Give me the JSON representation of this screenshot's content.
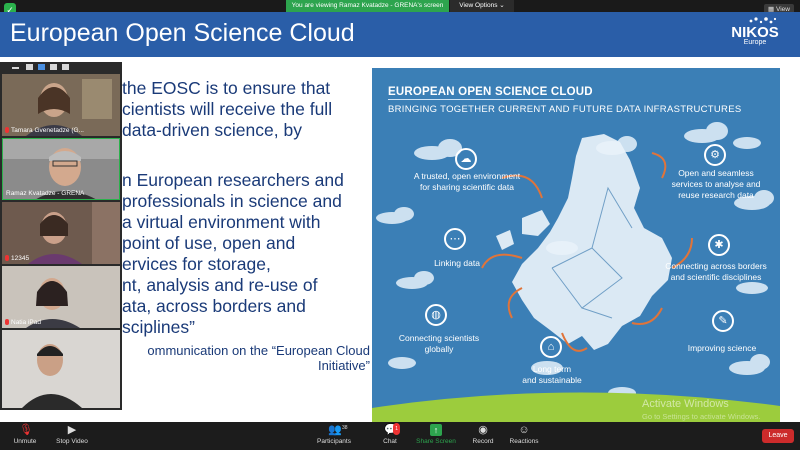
{
  "topbar": {
    "viewing_text": "You are viewing Ramaz Kvatadze - GRENA's screen",
    "view_options": "View Options ⌄",
    "view_label": "View"
  },
  "slide": {
    "title": "European Open Science Cloud",
    "logo": "NIKOS",
    "logo_sub": "Europe",
    "body": [
      "the EOSC is to ensure that",
      "cientists will receive the full",
      "data-driven science, by",
      "",
      "n European researchers and",
      "professionals in science and",
      "a virtual environment with",
      "point of use, open and",
      "ervices for storage,",
      "nt, analysis and re-use of",
      "ata, across borders and",
      "sciplines”"
    ],
    "quote_source_1": "ommunication on the “European Cloud",
    "quote_source_2": "Initiative”"
  },
  "poster": {
    "title": "EUROPEAN OPEN SCIENCE CLOUD",
    "subtitle": "BRINGING TOGETHER CURRENT AND FUTURE DATA INFRASTRUCTURES",
    "labels": {
      "trusted": [
        "A trusted, open environment",
        "for sharing scientific data"
      ],
      "seamless": [
        "Open and seamless",
        "services to analyse and",
        "reuse research data"
      ],
      "linking": [
        "Linking data"
      ],
      "borders": [
        "Connecting across borders",
        "and scientific disciplines"
      ],
      "scientists": [
        "Connecting scientists",
        "globally"
      ],
      "improving": [
        "Improving science"
      ],
      "longterm": [
        "Long term",
        "and sustainable"
      ]
    },
    "watermark_1": "Activate Windows",
    "watermark_2": "Go to Settings to activate Windows."
  },
  "participants": [
    {
      "name": "Tamara Gvenetadze (G..."
    },
    {
      "name": "Ramaz Kvatadze - GRENA"
    },
    {
      "name": "12345"
    },
    {
      "name": "Natia iPad"
    },
    {
      "name": ""
    }
  ],
  "toolbar": {
    "unmute": "Unmute",
    "stop_video": "Stop Video",
    "participants": "Participants",
    "participants_count": "38",
    "chat": "Chat",
    "chat_badge": "1",
    "share_screen": "Share Screen",
    "record": "Record",
    "reactions": "Reactions",
    "leave": "Leave"
  },
  "colors": {
    "slide_header": "#2a5ea8",
    "poster_bg": "#3b7fb6",
    "share_green": "#2da44e",
    "leave_red": "#cc2b2b"
  }
}
